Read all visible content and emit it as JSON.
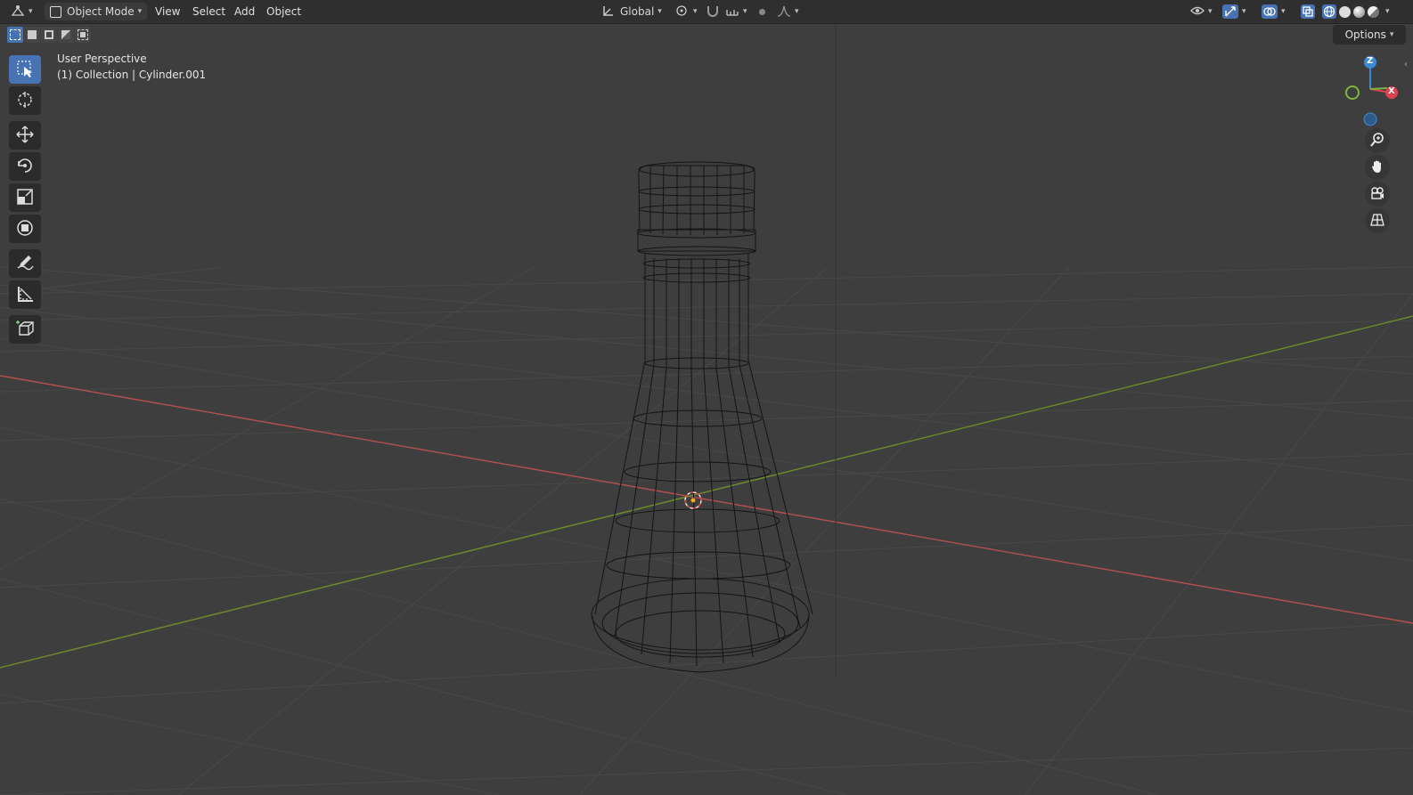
{
  "header": {
    "editor_type_icon": "editor-type-icon",
    "mode_label": "Object Mode",
    "menus": [
      "View",
      "Select",
      "Add",
      "Object"
    ],
    "orientation_label": "Global",
    "options_label": "Options"
  },
  "overlay": {
    "view_name": "User Perspective",
    "collection_info": "(1) Collection | Cylinder.001"
  },
  "toolbar": {
    "tools": [
      "select-box",
      "cursor",
      "move",
      "rotate",
      "scale",
      "transform",
      "annotate",
      "measure",
      "add-cube"
    ],
    "active_tool": "select-box"
  },
  "gizmo": {
    "axes": [
      "Z",
      "X"
    ],
    "colors": {
      "x": "#e0434f",
      "y": "#7ab73a",
      "z": "#3b8ad9"
    }
  },
  "navigation": [
    "zoom-icon",
    "pan-hand-icon",
    "camera-icon",
    "ortho-grid-icon"
  ],
  "colors": {
    "accent": "#4772b3",
    "x_axis": "#b45050",
    "y_axis": "#6e8c2a",
    "background": "#3e3e3e"
  }
}
